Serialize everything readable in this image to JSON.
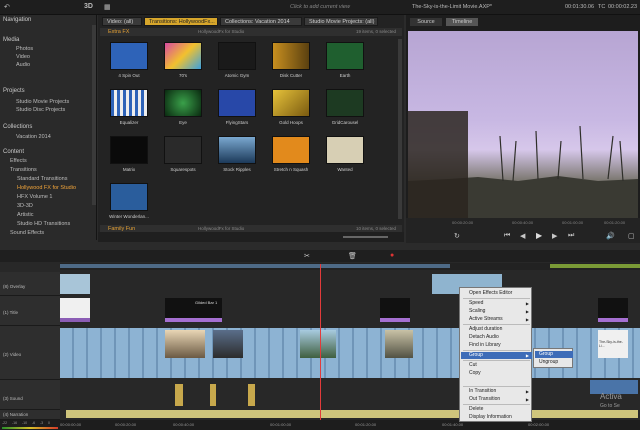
{
  "app": {
    "mode_3d": "3D",
    "tooltip": "Click to add current view",
    "movie_title": "The-Sky-is-the-Limit Movie.AXP*",
    "timecode_pos": "00:01:30.06",
    "tc_label": "TC",
    "timecode_dur": "00:00:02.23"
  },
  "nav": {
    "title": "Navigation",
    "sections": {
      "media": "Media",
      "projects": "Projects",
      "collections": "Collections",
      "content": "Content"
    },
    "items": {
      "photos": "Photos",
      "video": "Video",
      "audio": "Audio",
      "movie_projects": "Studio Movie Projects",
      "disc_projects": "Studio Disc Projects",
      "vacation": "Vacation 2014",
      "effects": "Effects",
      "transitions": "Transitions",
      "standard": "Standard Transitions",
      "hollywood": "Hollywood FX for Studio",
      "hfx_vol1": "HFX Volume 1",
      "d3": "3D-3D",
      "artistic": "Artistic",
      "studio_hd": "Studio HD Transitions",
      "sound_effects": "Sound Effects"
    }
  },
  "library": {
    "tabs": [
      "Video: (all)",
      "Transitions: HollywoodFx...",
      "Collections: Vacation 2014",
      "Studio Movie Projects: (all)"
    ],
    "section1": "Extra FX",
    "section1_meta": "HollywoodFx for Studio",
    "section1_count": "19 items, 0 selected",
    "section2": "Family Fun",
    "section2_meta": "HollywoodFx for Studio",
    "section2_count": "10 items, 0 selected",
    "thumbs": [
      "4 Spin Out",
      "70's",
      "Atomic Gym",
      "Disk Cutter",
      "Earth",
      "Equalizer",
      "Eye",
      "FlyingStars",
      "Gold Hoops",
      "GridCarousel",
      "Matrix",
      "Squarespots",
      "Stock Ripples",
      "Stretch n Squash",
      "Wanted",
      "Winter Wonderlan..."
    ]
  },
  "preview": {
    "tabs": [
      "Source",
      "Timeline"
    ],
    "scale": [
      "00:00:20.00",
      "00:00:40.00",
      "00:01:00.00",
      "00:01:20.00"
    ]
  },
  "timeline": {
    "tracks": [
      "(8) Overlay",
      "(1) Title",
      "(2) Video",
      "(3) Sound",
      "(4) Narration"
    ],
    "ruler": [
      "00:00:00.00",
      "00:00:20.00",
      "00:00:40.00",
      "00:01:00.00",
      "00:01:20.00",
      "00:01:40.00",
      "00:02:00.00"
    ],
    "clip_title": "Gilded Bar 1",
    "clip_sky": "The-Sky-is-the-Li...",
    "vu_marks": [
      "-22",
      "-16",
      "-10",
      "-6",
      "-3",
      "0"
    ]
  },
  "context_menu": {
    "items": [
      "Open Effects Editor",
      "Speed",
      "Scaling",
      "Active Streams",
      "Adjust duration",
      "Detach Audio",
      "Find in Library",
      "Group",
      "Cut",
      "Copy",
      "In Transition",
      "Out Transition",
      "Delete",
      "Display Information"
    ],
    "submenu": [
      "Group",
      "Ungroup"
    ]
  },
  "watermark": {
    "line1": "Activa",
    "line2": "Go to Se"
  }
}
